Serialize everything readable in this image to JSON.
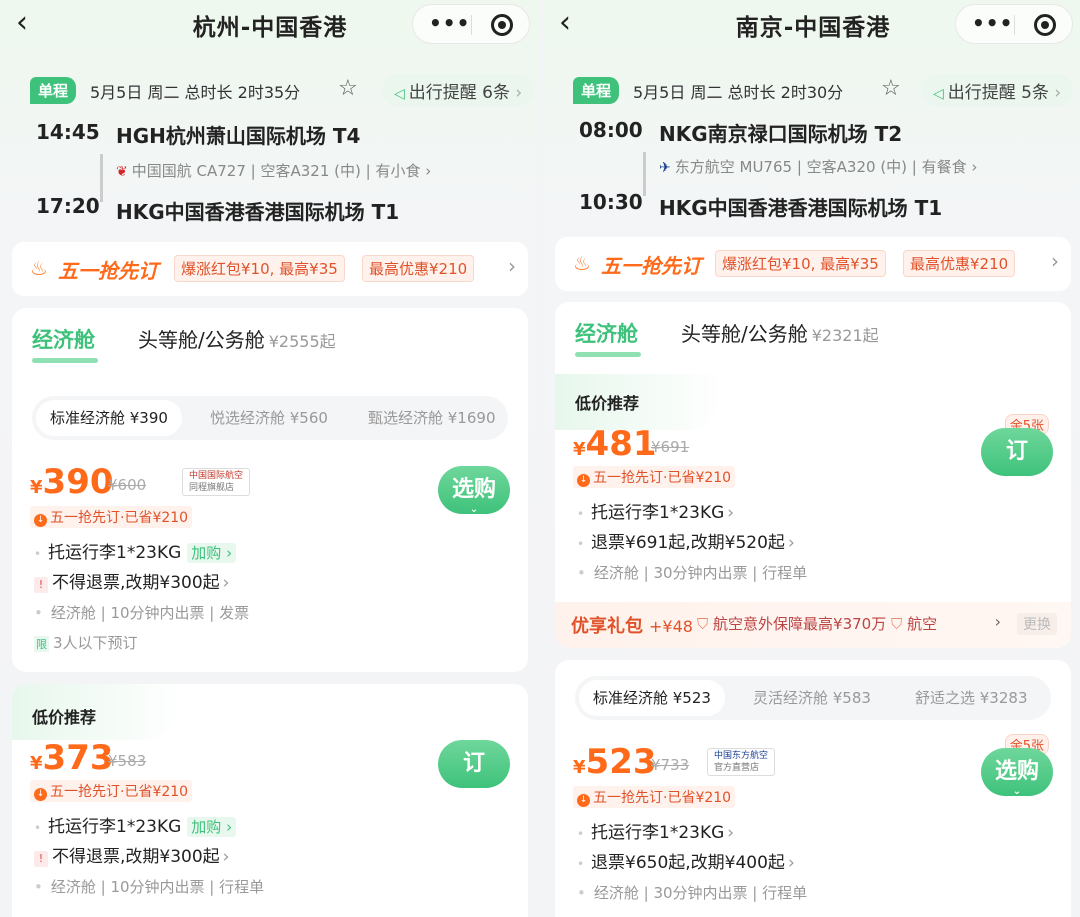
{
  "left": {
    "title": "杭州-中国香港",
    "trip_type": "单程",
    "date_info": "5月5日 周二",
    "duration": "总时长 2时35分",
    "reminder": "出行提醒 6条",
    "dep_time": "14:45",
    "dep_airport": "HGH杭州萧山国际机场 T4",
    "airline_info": "中国国航 CA727",
    "aircraft": "空客A321 (中)",
    "meal": "有小食",
    "arr_time": "17:20",
    "arr_airport": "HKG中国香港香港国际机场 T1",
    "promo_title": "五一抢先订",
    "promo_tag1": "爆涨红包¥10, 最高¥35",
    "promo_tag2": "最高优惠¥210",
    "tab_economy": "经济舱",
    "tab_first": "头等舱/公务舱",
    "tab_first_price": "¥2555起",
    "subtab1": "标准经济舱 ¥390",
    "subtab2": "悦选经济舱 ¥560",
    "subtab3": "甄选经济舱 ¥1690",
    "offer1": {
      "yen": "¥",
      "price": "390",
      "old": "¥600",
      "logo_line1": "中国国际航空",
      "logo_line2": "同程旗舰店",
      "save": "五一抢先订·已省¥210",
      "baggage": "托运行李1*23KG",
      "baggage_add": "加购",
      "refund": "不得退票,改期¥300起",
      "meta": "经济舱 | 10分钟内出票 | 发票",
      "limit_tag": "限",
      "limit": "3人以下预订",
      "button": "选购"
    },
    "low_title": "低价推荐",
    "offer2": {
      "yen": "¥",
      "price": "373",
      "old": "¥583",
      "save": "五一抢先订·已省¥210",
      "baggage": "托运行李1*23KG",
      "baggage_add": "加购",
      "refund": "不得退票,改期¥300起",
      "meta": "经济舱 | 10分钟内出票 | 行程单",
      "button": "订"
    }
  },
  "right": {
    "title": "南京-中国香港",
    "trip_type": "单程",
    "date_info": "5月5日 周二",
    "duration": "总时长 2时30分",
    "reminder": "出行提醒 5条",
    "dep_time": "08:00",
    "dep_airport": "NKG南京禄口国际机场 T2",
    "airline_info": "东方航空 MU765",
    "aircraft": "空客A320 (中)",
    "meal": "有餐食",
    "arr_time": "10:30",
    "arr_airport": "HKG中国香港香港国际机场 T1",
    "promo_title": "五一抢先订",
    "promo_tag1": "爆涨红包¥10, 最高¥35",
    "promo_tag2": "最高优惠¥210",
    "tab_economy": "经济舱",
    "tab_first": "头等舱/公务舱",
    "tab_first_price": "¥2321起",
    "low_title": "低价推荐",
    "offer1": {
      "yen": "¥",
      "price": "481",
      "old": "¥691",
      "stock": "余5张",
      "save": "五一抢先订·已省¥210",
      "baggage": "托运行李1*23KG",
      "refund": "退票¥691起,改期¥520起",
      "meta": "经济舱 | 30分钟内出票 | 行程单",
      "button": "订"
    },
    "gift_title": "优享礼包",
    "gift_price": "+¥48",
    "gift_text": "航空意外保障最高¥370万",
    "gift_text2": "航空",
    "gift_change": "更换",
    "subtab1": "标准经济舱 ¥523",
    "subtab2": "灵活经济舱 ¥583",
    "subtab3": "舒适之选 ¥3283",
    "offer2": {
      "yen": "¥",
      "price": "523",
      "old": "¥733",
      "logo_line1": "中国东方航空",
      "logo_line2": "官方直营店",
      "stock": "余5张",
      "save": "五一抢先订·已省¥210",
      "baggage": "托运行李1*23KG",
      "refund": "退票¥650起,改期¥400起",
      "meta": "经济舱 | 30分钟内出票 | 行程单",
      "button": "选购"
    }
  }
}
